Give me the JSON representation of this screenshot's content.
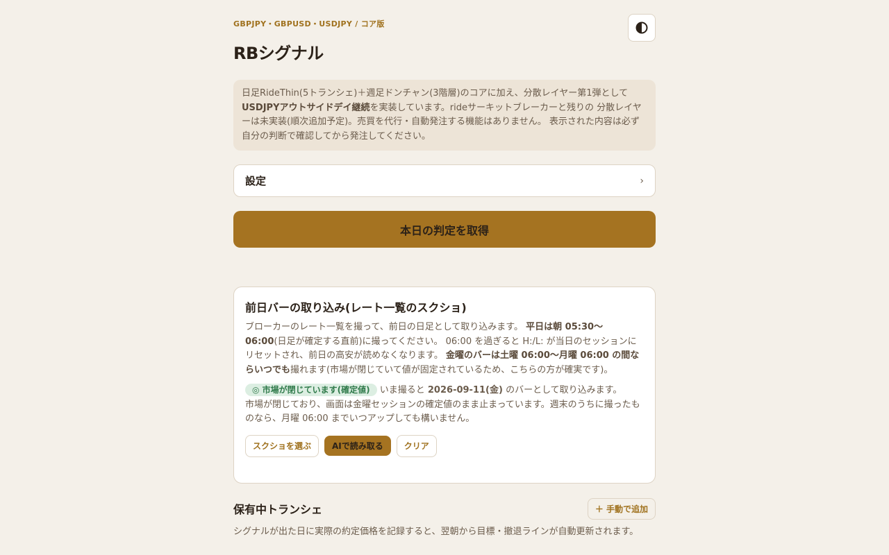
{
  "header": {
    "eyebrow": "GBPJPY・GBPUSD・USDJPY / コア版",
    "title": "RBシグナル",
    "theme_icon": "contrast-icon"
  },
  "notice": {
    "text_1": "日足RideThin(5トランシェ)＋週足ドンチャン(3階層)のコアに加え、分散レイヤー第1弾として",
    "strong_1": "USDJPYアウトサイドデイ継続",
    "text_2": "を実装しています。rideサーキットブレーカーと残りの 分散レイヤーは未実装(順次追加予定)。売買を代行・自動発注する機能はありません。 表示された内容は必ず自分の判断で確認してから発注してください。"
  },
  "settings": {
    "label": "設定",
    "chevron": "›"
  },
  "primary_action": {
    "label": "本日の判定を取得"
  },
  "import_card": {
    "title": "前日バーの取り込み(レート一覧のスクショ)",
    "desc_1": "ブローカーのレート一覧を撮って、前日の日足として取り込みます。 ",
    "desc_strong_1": "平日は朝 05:30〜06:00",
    "desc_2": "(日足が確定する直前)に撮ってください。 06:00 を過ぎると H:/L: が当日のセッションにリセットされ、前日の高安が読めなくなります。 ",
    "desc_strong_2": "金曜のバーは土曜 06:00〜月曜 06:00 の間ならいつでも",
    "desc_3": "撮れます(市場が閉じていて値が固定されているため、こちらの方が確実です)。",
    "status_badge": "◎ 市場が閉じています(確定値)",
    "status_text_1": " いま撮ると ",
    "status_date": "2026-09-11(金)",
    "status_text_2": " のバーとして取り込みます。",
    "status_note": "市場が閉じており、画面は金曜セッションの確定値のまま止まっています。週末のうちに撮ったものなら、月曜 06:00 までいつアップしても構いません。",
    "buttons": {
      "choose": "スクショを選ぶ",
      "ai_read": "AIで読み取る",
      "clear": "クリア"
    }
  },
  "tranche_section": {
    "title": "保有中トランシェ",
    "add_button": "＋ 手動で追加",
    "desc": "シグナルが出た日に実際の約定価格を記録すると、翌朝から目標・撤退ラインが自動更新されます。"
  },
  "colors": {
    "background": "#f4f0e9",
    "accent": "#a57321",
    "accent_text": "#a0721f",
    "success_bg": "#dceee2",
    "success_text": "#2f7a4a"
  }
}
